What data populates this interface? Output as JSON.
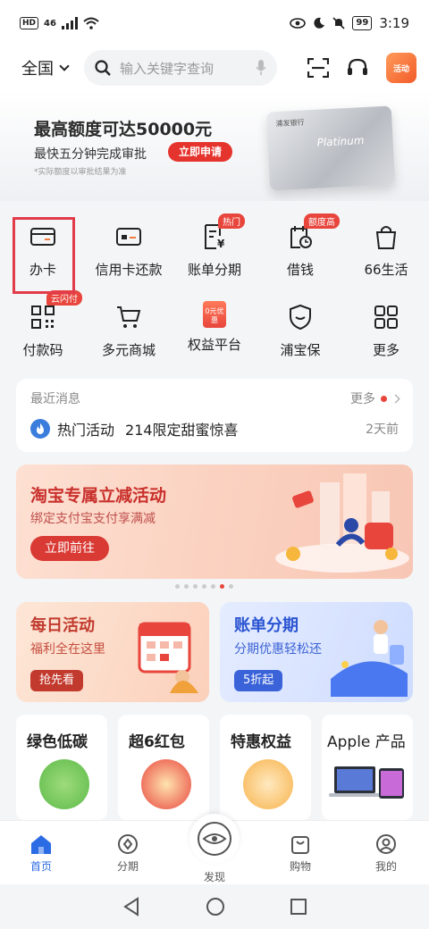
{
  "status_bar": {
    "hd": "HD",
    "signal": "46",
    "battery": "99",
    "time": "3:19"
  },
  "header": {
    "city": "全国",
    "search_placeholder": "输入关键字查询",
    "avatar_text": "活动"
  },
  "banner": {
    "title": "最高额度可达50000元",
    "subtitle": "最快五分钟完成审批",
    "cta": "立即申请",
    "note": "*实际额度以审批结果为准",
    "card_bank": "浦发银行",
    "card_name": "Platinum"
  },
  "menu": {
    "items": [
      {
        "label": "办卡",
        "icon": "card-icon"
      },
      {
        "label": "信用卡还款",
        "icon": "card-repay-icon"
      },
      {
        "label": "账单分期",
        "icon": "bill-icon",
        "badge": "热门"
      },
      {
        "label": "借钱",
        "icon": "borrow-icon",
        "badge": "额度高"
      },
      {
        "label": "66生活",
        "icon": "bag-icon"
      },
      {
        "label": "付款码",
        "icon": "qrcode-icon",
        "badge": "云闪付"
      },
      {
        "label": "多元商城",
        "icon": "cart-icon"
      },
      {
        "label": "权益平台",
        "icon": "coupon-icon",
        "icon_text": "0元优惠"
      },
      {
        "label": "浦宝保",
        "icon": "shield-icon"
      },
      {
        "label": "更多",
        "icon": "grid-icon"
      }
    ]
  },
  "messages": {
    "title": "最近消息",
    "more": "更多",
    "tag": "热门活动",
    "text": "214限定甜蜜惊喜",
    "time": "2天前"
  },
  "promo": {
    "title": "淘宝专属立减活动",
    "subtitle": "绑定支付宝支付享满减",
    "button": "立即前往",
    "slide_count": 7,
    "active_slide": 6
  },
  "activities": [
    {
      "title": "每日活动",
      "subtitle": "福利全在这里",
      "button": "抢先看"
    },
    {
      "title": "账单分期",
      "subtitle": "分期优惠轻松还",
      "button": "5折起"
    }
  ],
  "quick_cards": [
    {
      "title": "绿色低碳"
    },
    {
      "title": "超6红包"
    },
    {
      "title": "特惠权益"
    },
    {
      "title": "Apple 产品"
    }
  ],
  "tabbar": {
    "home": "首页",
    "installment": "分期",
    "discover": "发现",
    "shop": "购物",
    "mine": "我的"
  },
  "colors": {
    "accent": "#2b6be3",
    "red": "#e8453c",
    "highlight": "#e23b4a"
  }
}
